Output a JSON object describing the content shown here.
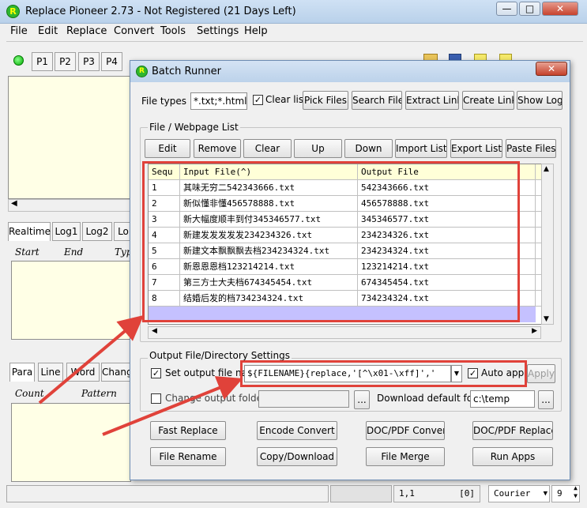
{
  "app": {
    "title": "Replace Pioneer 2.73 - Not Registered (21 Days Left)",
    "icon_letter": "R",
    "win_buttons": [
      "—",
      "□",
      "✕"
    ]
  },
  "menu": [
    "File",
    "Edit",
    "Replace",
    "Convert",
    "Tools",
    "Settings",
    "Help"
  ],
  "ptabs": [
    "P1",
    "P2",
    "P3",
    "P4"
  ],
  "left_panels": {
    "log_tabs": [
      "Realtime",
      "Log1",
      "Log2",
      "Lo"
    ],
    "log_headers": [
      "Start",
      "End",
      "Typ"
    ],
    "bottom_tabs": [
      "Para",
      "Line",
      "Word",
      "Chang"
    ],
    "bottom_headers": [
      "Count",
      "Pattern"
    ]
  },
  "status": {
    "position": "1,1",
    "sel": "[0]",
    "font": "Courier",
    "size": "9"
  },
  "dialog": {
    "title": "Batch Runner",
    "close": "✕",
    "file_types_label": "File types =>",
    "file_types_value": "*.txt;*.html;*.ht",
    "clear_list_label": "Clear list",
    "clear_list_checked": true,
    "top_buttons": [
      "Pick Files",
      "Search Files",
      "Extract Links",
      "Create Links",
      "Show Logs"
    ],
    "list_group_label": "File / Webpage List",
    "list_buttons": [
      "Edit",
      "Remove",
      "Clear",
      "Up",
      "Down",
      "Import List",
      "Export List",
      "Paste Files"
    ],
    "grid_headers": [
      "Sequ",
      "Input File(^)",
      "Output File"
    ],
    "rows": [
      {
        "seq": "1",
        "input": "其味无穷二542343666.txt",
        "output": "542343666.txt"
      },
      {
        "seq": "2",
        "input": "新似懂非懂456578888.txt",
        "output": "456578888.txt"
      },
      {
        "seq": "3",
        "input": "新大幅度顺丰到付345346577.txt",
        "output": "345346577.txt"
      },
      {
        "seq": "4",
        "input": "新建发发发发发234234326.txt",
        "output": "234234326.txt"
      },
      {
        "seq": "5",
        "input": "新建文本飘飘飘去档234234324.txt",
        "output": "234234324.txt"
      },
      {
        "seq": "6",
        "input": "新恩恩恩档123214214.txt",
        "output": "123214214.txt"
      },
      {
        "seq": "7",
        "input": "第三方士大夫档674345454.txt",
        "output": "674345454.txt"
      },
      {
        "seq": "8",
        "input": "结婚后发的档734234324.txt",
        "output": "734234324.txt"
      }
    ],
    "output_group_label": "Output File/Directory Settings",
    "set_output_label": "Set output file name:",
    "set_output_checked": true,
    "output_pattern": "${FILENAME}{replace,'[^\\x01-\\xff]','",
    "auto_apply_label": "Auto apply",
    "auto_apply_checked": true,
    "apply_label": "Apply",
    "change_folder_label": "Change output folder:",
    "change_folder_checked": false,
    "browse_label": "...",
    "download_label": "Download default folder:",
    "download_value": "c:\\temp",
    "action_buttons": [
      "Fast Replace",
      "Encode Convert",
      "DOC/PDF Convert",
      "DOC/PDF Replace",
      "File Rename",
      "Copy/Download",
      "File Merge",
      "Run Apps"
    ]
  },
  "colors": {
    "annotation": "#e0423a",
    "grid_header": "#ffffd8",
    "panel": "#ffffe6"
  }
}
